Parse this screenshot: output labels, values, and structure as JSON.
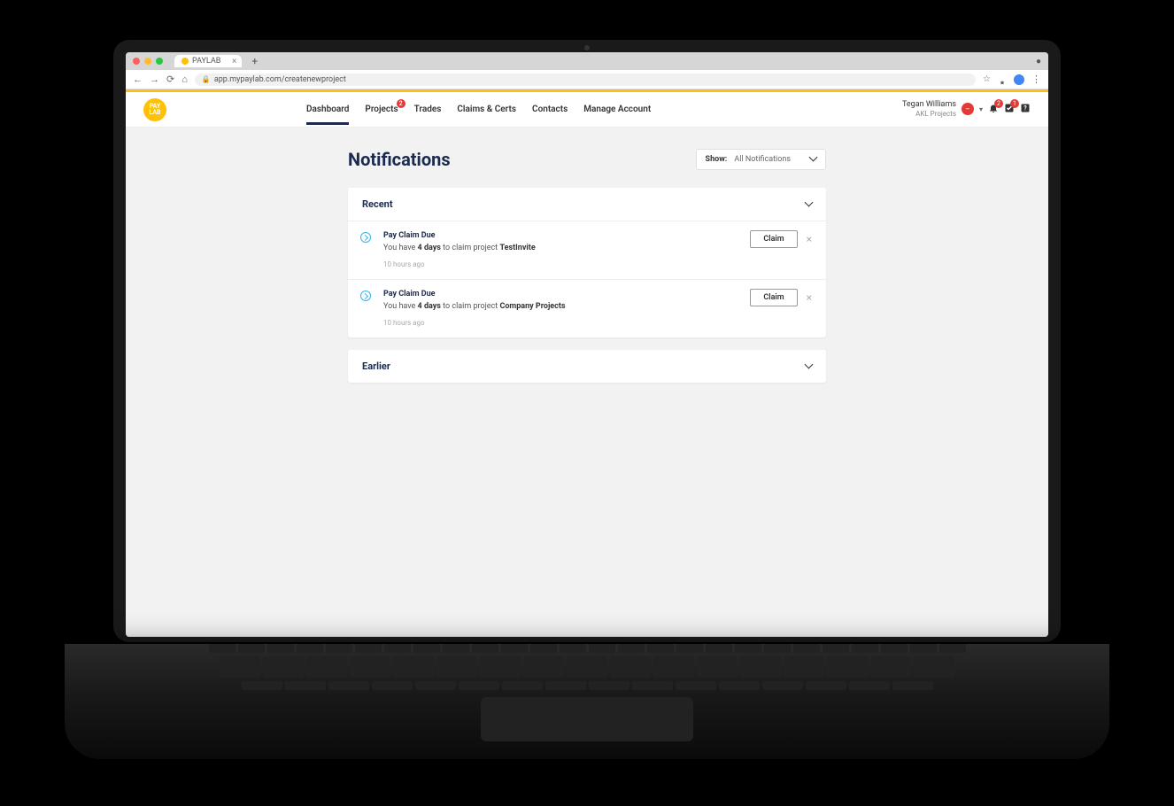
{
  "browser": {
    "tab_title": "PAYLAB",
    "url": "app.mypaylab.com/createnewproject"
  },
  "nav": {
    "logo_text": "PAY LAB",
    "items": [
      {
        "label": "Dashboard",
        "active": true
      },
      {
        "label": "Projects",
        "badge": "2"
      },
      {
        "label": "Trades"
      },
      {
        "label": "Claims & Certs"
      },
      {
        "label": "Contacts"
      },
      {
        "label": "Manage Account"
      }
    ]
  },
  "user": {
    "name": "Tegan Williams",
    "org": "AKL Projects",
    "bell_badge": "2",
    "check_badge": "1"
  },
  "page": {
    "title": "Notifications",
    "filter_label": "Show:",
    "filter_value": "All Notifications"
  },
  "sections": {
    "recent": {
      "title": "Recent",
      "items": [
        {
          "title": "Pay Claim Due",
          "prefix": "You have ",
          "days": "4 days",
          "mid": " to claim project ",
          "project": "TestInvite",
          "time": "10 hours ago",
          "action": "Claim"
        },
        {
          "title": "Pay Claim Due",
          "prefix": "You have ",
          "days": "4 days",
          "mid": " to claim project ",
          "project": "Company Projects",
          "time": "10 hours ago",
          "action": "Claim"
        }
      ]
    },
    "earlier": {
      "title": "Earlier"
    }
  }
}
